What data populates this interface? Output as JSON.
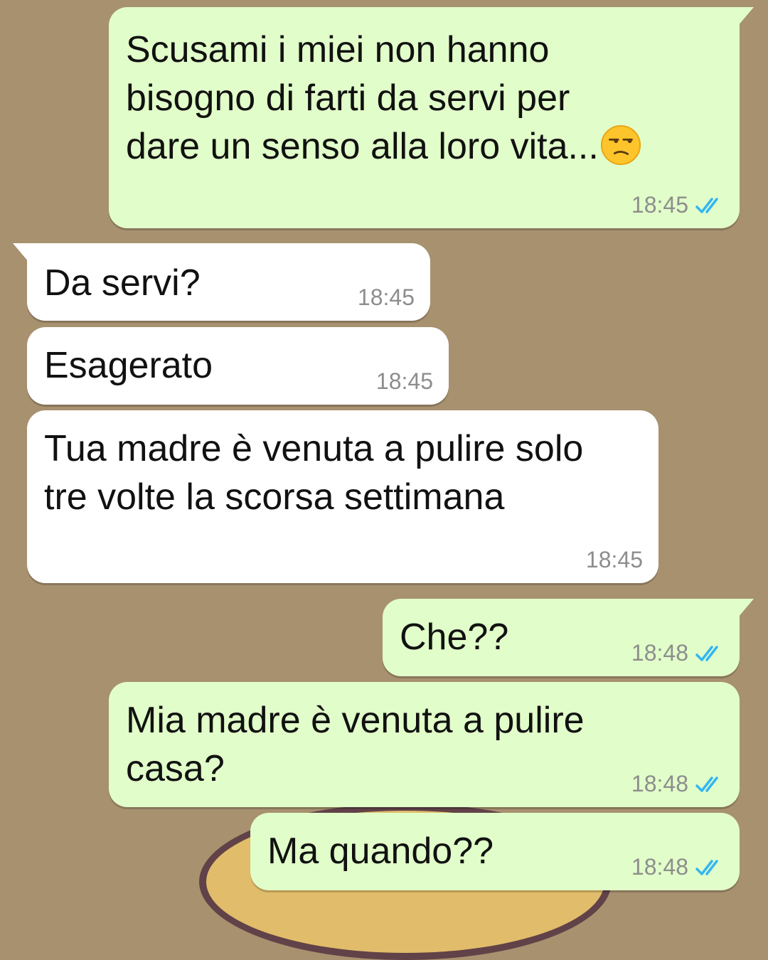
{
  "colors": {
    "background": "#A7916F",
    "outgoing_bubble": "#E1FDC9",
    "incoming_bubble": "#FFFFFF",
    "timestamp": "#8D8D8D",
    "read_ticks": "#34B7F1"
  },
  "messages": [
    {
      "direction": "outgoing",
      "text": "Scusami i miei non hanno\nbisogno di farti da servi per\ndare un senso alla loro vita...",
      "emoji": "unamused-face",
      "time": "18:45",
      "status": "read"
    },
    {
      "direction": "incoming",
      "text": "Da servi?",
      "time": "18:45"
    },
    {
      "direction": "incoming",
      "text": "Esagerato",
      "time": "18:45"
    },
    {
      "direction": "incoming",
      "text": "Tua madre è venuta a pulire solo\ntre volte la scorsa settimana",
      "time": "18:45"
    },
    {
      "direction": "outgoing",
      "text": "Che??",
      "time": "18:48",
      "status": "read"
    },
    {
      "direction": "outgoing",
      "text": "Mia madre è venuta a pulire\ncasa?",
      "time": "18:48",
      "status": "read"
    },
    {
      "direction": "outgoing",
      "text": "Ma quando??",
      "time": "18:48",
      "status": "read"
    }
  ]
}
